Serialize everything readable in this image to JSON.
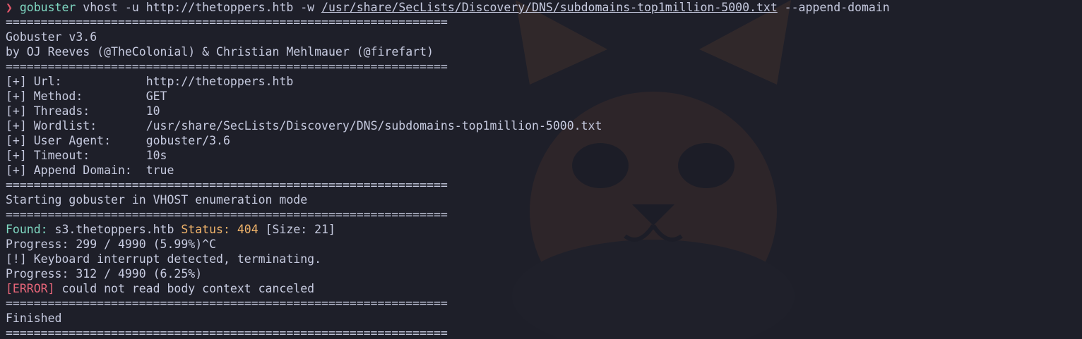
{
  "command": {
    "prompt_symbol": "❯",
    "program": "gobuster",
    "args_before": " vhost -u http://thetoppers.htb -w ",
    "wordlist_path": "/usr/share/SecLists/Discovery/DNS/subdomains-top1million-5000.txt",
    "args_after": " --append-domain"
  },
  "separator": "===============================================================",
  "banner": {
    "title": "Gobuster v3.6",
    "authors": "by OJ Reeves (@TheColonial) & Christian Mehlmauer (@firefart)"
  },
  "config": [
    {
      "key": "[+] Url:            ",
      "value": "http://thetoppers.htb"
    },
    {
      "key": "[+] Method:         ",
      "value": "GET"
    },
    {
      "key": "[+] Threads:        ",
      "value": "10"
    },
    {
      "key": "[+] Wordlist:       ",
      "value": "/usr/share/SecLists/Discovery/DNS/subdomains-top1million-5000.txt"
    },
    {
      "key": "[+] User Agent:     ",
      "value": "gobuster/3.6"
    },
    {
      "key": "[+] Timeout:        ",
      "value": "10s"
    },
    {
      "key": "[+] Append Domain:  ",
      "value": "true"
    }
  ],
  "mode_line": "Starting gobuster in VHOST enumeration mode",
  "found": {
    "label": "Found:",
    "host": " s3.thetoppers.htb ",
    "status_label": "Status:",
    "status_code": " 404",
    "size": " [Size: 21]"
  },
  "progress_1": "Progress: 299 / 4990 (5.99%)^C",
  "interrupt": "[!] Keyboard interrupt detected, terminating.",
  "progress_2": "Progress: 312 / 4990 (6.25%)",
  "error": {
    "tag": "[ERROR]",
    "message": " could not read body context canceled"
  },
  "finished": "Finished",
  "colors": {
    "background": "#1e1f29",
    "text": "#c7cbe0",
    "prompt": "#e0566a",
    "command": "#7fd8c2",
    "status": "#f0b36a",
    "error": "#e8667a"
  }
}
